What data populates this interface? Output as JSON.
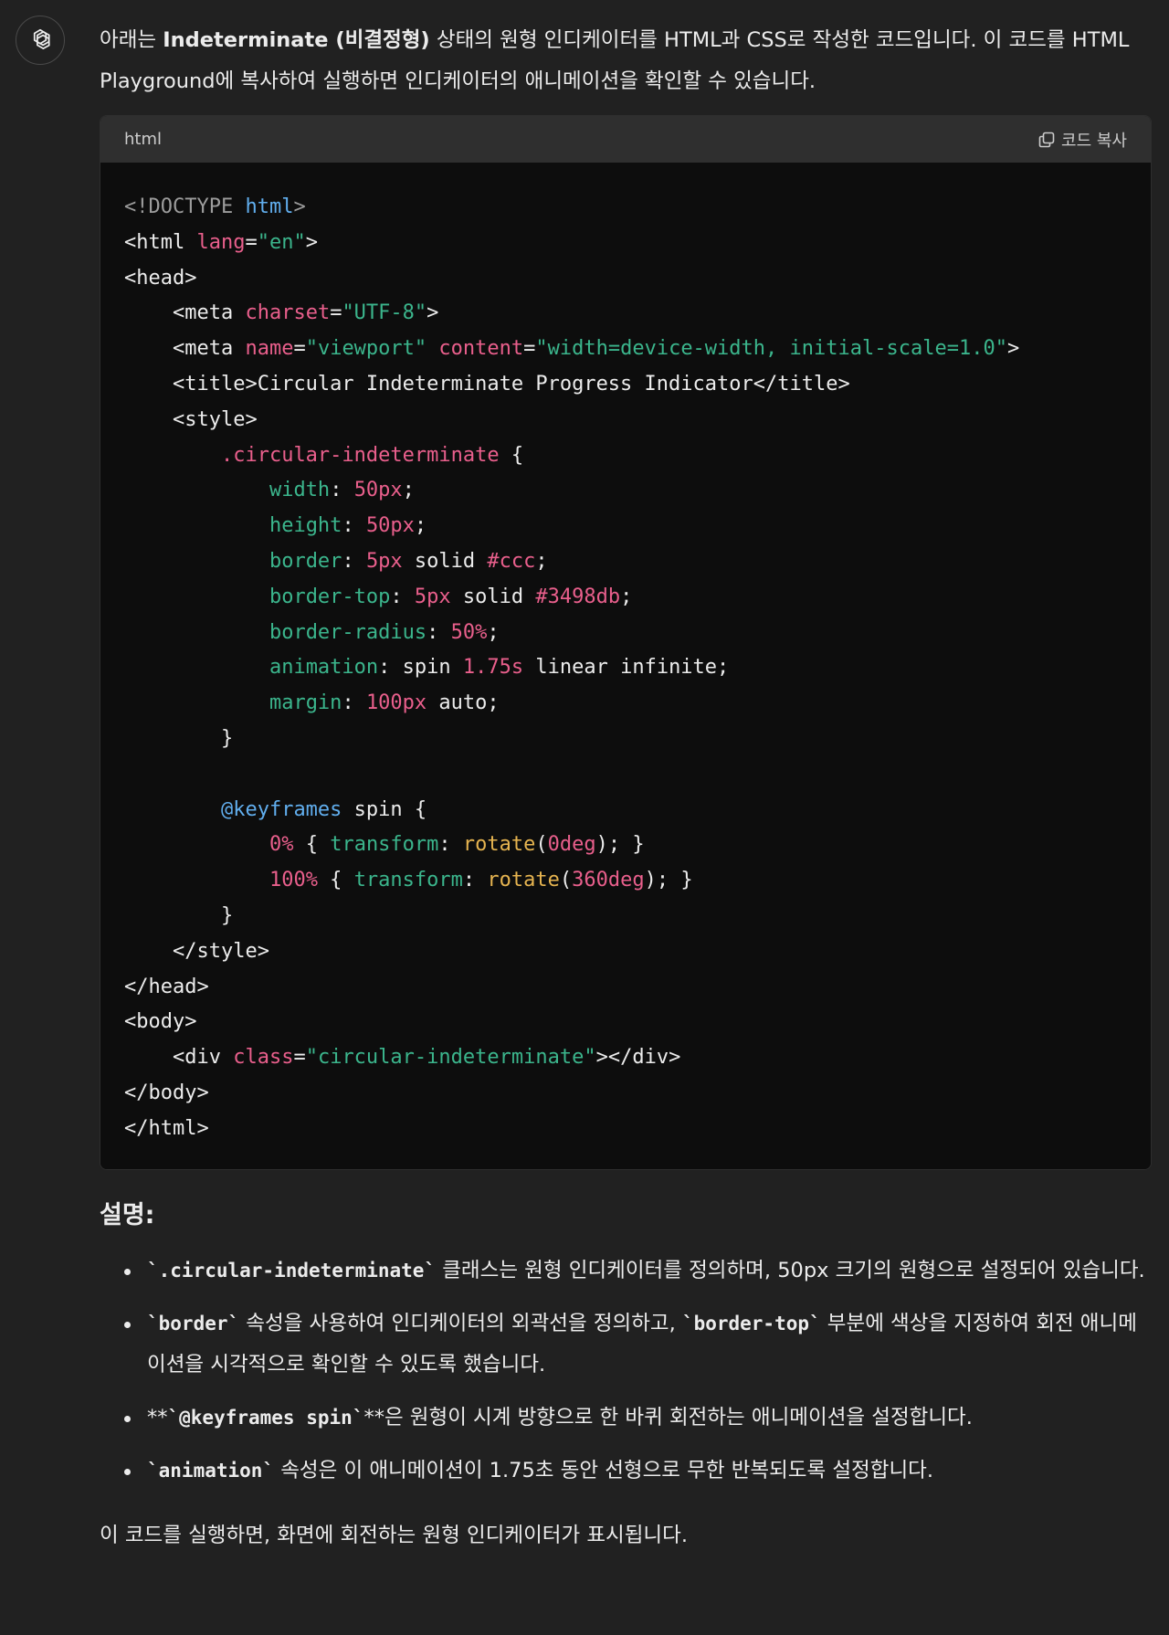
{
  "assistant": {
    "avatar_icon": "openai-logo-icon"
  },
  "intro": {
    "prefix": "아래는 ",
    "bold": "Indeterminate (비결정형)",
    "suffix": " 상태의 원형 인디케이터를 HTML과 CSS로 작성한 코드입니다. 이 코드를 HTML Playground에 복사하여 실행하면 인디케이터의 애니메이션을 확인할 수 있습니다."
  },
  "code_block": {
    "language": "html",
    "copy_label": "코드 복사",
    "copy_icon": "copy-icon",
    "lines": [
      [
        [
          "punc",
          "<!DOCTYPE "
        ],
        [
          "kw",
          "html"
        ],
        [
          "punc",
          ">"
        ]
      ],
      [
        [
          "tag",
          "<html "
        ],
        [
          "attr",
          "lang"
        ],
        [
          "plain",
          "="
        ],
        [
          "str",
          "\"en\""
        ],
        [
          "tag",
          ">"
        ]
      ],
      [
        [
          "tag",
          "<head>"
        ]
      ],
      [
        [
          "plain",
          "    "
        ],
        [
          "tag",
          "<meta "
        ],
        [
          "attr",
          "charset"
        ],
        [
          "plain",
          "="
        ],
        [
          "str",
          "\"UTF-8\""
        ],
        [
          "tag",
          ">"
        ]
      ],
      [
        [
          "plain",
          "    "
        ],
        [
          "tag",
          "<meta "
        ],
        [
          "attr",
          "name"
        ],
        [
          "plain",
          "="
        ],
        [
          "str",
          "\"viewport\""
        ],
        [
          "plain",
          " "
        ],
        [
          "attr",
          "content"
        ],
        [
          "plain",
          "="
        ],
        [
          "str",
          "\"width=device-width, initial-scale=1.0\""
        ],
        [
          "tag",
          ">"
        ]
      ],
      [
        [
          "plain",
          "    "
        ],
        [
          "tag",
          "<title>"
        ],
        [
          "plain",
          "Circular Indeterminate Progress Indicator"
        ],
        [
          "tag",
          "</title>"
        ]
      ],
      [
        [
          "plain",
          "    "
        ],
        [
          "tag",
          "<style>"
        ]
      ],
      [
        [
          "plain",
          "        "
        ],
        [
          "sel",
          ".circular-indeterminate"
        ],
        [
          "plain",
          " {"
        ]
      ],
      [
        [
          "plain",
          "            "
        ],
        [
          "prop",
          "width"
        ],
        [
          "plain",
          ": "
        ],
        [
          "num",
          "50px"
        ],
        [
          "plain",
          ";"
        ]
      ],
      [
        [
          "plain",
          "            "
        ],
        [
          "prop",
          "height"
        ],
        [
          "plain",
          ": "
        ],
        [
          "num",
          "50px"
        ],
        [
          "plain",
          ";"
        ]
      ],
      [
        [
          "plain",
          "            "
        ],
        [
          "prop",
          "border"
        ],
        [
          "plain",
          ": "
        ],
        [
          "num",
          "5px"
        ],
        [
          "plain",
          " solid "
        ],
        [
          "num",
          "#ccc"
        ],
        [
          "plain",
          ";"
        ]
      ],
      [
        [
          "plain",
          "            "
        ],
        [
          "prop",
          "border-top"
        ],
        [
          "plain",
          ": "
        ],
        [
          "num",
          "5px"
        ],
        [
          "plain",
          " solid "
        ],
        [
          "num",
          "#3498db"
        ],
        [
          "plain",
          ";"
        ]
      ],
      [
        [
          "plain",
          "            "
        ],
        [
          "prop",
          "border-radius"
        ],
        [
          "plain",
          ": "
        ],
        [
          "num",
          "50%"
        ],
        [
          "plain",
          ";"
        ]
      ],
      [
        [
          "plain",
          "            "
        ],
        [
          "prop",
          "animation"
        ],
        [
          "plain",
          ": spin "
        ],
        [
          "num",
          "1.75s"
        ],
        [
          "plain",
          " linear infinite;"
        ]
      ],
      [
        [
          "plain",
          "            "
        ],
        [
          "prop",
          "margin"
        ],
        [
          "plain",
          ": "
        ],
        [
          "num",
          "100px"
        ],
        [
          "plain",
          " auto;"
        ]
      ],
      [
        [
          "plain",
          "        }"
        ]
      ],
      [
        [
          "plain",
          ""
        ]
      ],
      [
        [
          "plain",
          "        "
        ],
        [
          "at",
          "@keyframes"
        ],
        [
          "plain",
          " spin {"
        ]
      ],
      [
        [
          "plain",
          "            "
        ],
        [
          "num",
          "0%"
        ],
        [
          "plain",
          " { "
        ],
        [
          "prop",
          "transform"
        ],
        [
          "plain",
          ": "
        ],
        [
          "fn",
          "rotate"
        ],
        [
          "plain",
          "("
        ],
        [
          "num",
          "0deg"
        ],
        [
          "plain",
          "); }"
        ]
      ],
      [
        [
          "plain",
          "            "
        ],
        [
          "num",
          "100%"
        ],
        [
          "plain",
          " { "
        ],
        [
          "prop",
          "transform"
        ],
        [
          "plain",
          ": "
        ],
        [
          "fn",
          "rotate"
        ],
        [
          "plain",
          "("
        ],
        [
          "num",
          "360deg"
        ],
        [
          "plain",
          "); }"
        ]
      ],
      [
        [
          "plain",
          "        }"
        ]
      ],
      [
        [
          "plain",
          "    "
        ],
        [
          "tag",
          "</style>"
        ]
      ],
      [
        [
          "tag",
          "</head>"
        ]
      ],
      [
        [
          "tag",
          "<body>"
        ]
      ],
      [
        [
          "plain",
          "    "
        ],
        [
          "tag",
          "<div "
        ],
        [
          "attr",
          "class"
        ],
        [
          "plain",
          "="
        ],
        [
          "str",
          "\"circular-indeterminate\""
        ],
        [
          "tag",
          "></div>"
        ]
      ],
      [
        [
          "tag",
          "</body>"
        ]
      ],
      [
        [
          "tag",
          "</html>"
        ]
      ]
    ]
  },
  "explanation": {
    "heading": "설명:",
    "items": [
      {
        "code": "`.circular-indeterminate`",
        "text": " 클래스는 원형 인디케이터를 정의하며, 50px 크기의 원형으로 설정되어 있습니다."
      },
      {
        "code": "`border`",
        "text": " 속성을 사용하여 인디케이터의 외곽선을 정의하고, ",
        "code2": "`border-top`",
        "text2": " 부분에 색상을 지정하여 회전 애니메이션을 시각적으로 확인할 수 있도록 했습니다."
      },
      {
        "pre": "**",
        "code": "`@keyframes spin`",
        "text": "**은 원형이 시계 방향으로 한 바퀴 회전하는 애니메이션을 설정합니다."
      },
      {
        "code": "`animation`",
        "text": " 속성은 이 애니메이션이 1.75초 동안 선형으로 무한 반복되도록 설정합니다."
      }
    ]
  },
  "closing": "이 코드를 실행하면, 화면에 회전하는 원형 인디케이터가 표시됩니다."
}
